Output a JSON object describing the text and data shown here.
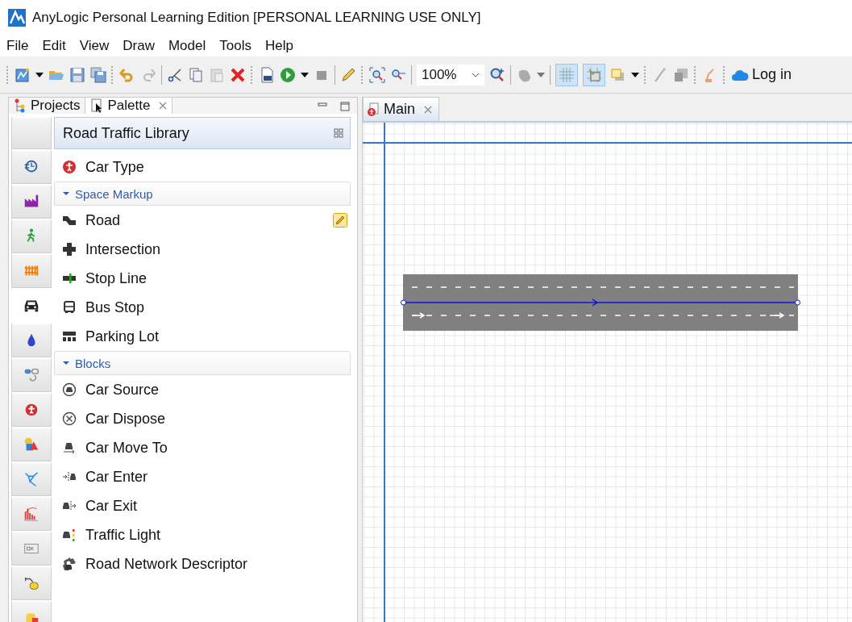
{
  "window": {
    "title": "AnyLogic Personal Learning Edition [PERSONAL LEARNING USE ONLY]"
  },
  "menu": [
    "File",
    "Edit",
    "View",
    "Draw",
    "Model",
    "Tools",
    "Help"
  ],
  "toolbar": {
    "zoom": "100%",
    "grid_toggle": {
      "selected": true
    },
    "snap_toggle": {
      "selected": true
    },
    "login": "Log in"
  },
  "panel_tabs": [
    {
      "label": "Projects",
      "selected": false
    },
    {
      "label": "Palette",
      "selected": true
    }
  ],
  "palette": {
    "categories": [
      {
        "kind": "blank",
        "selected": false
      },
      {
        "kind": "process",
        "selected": false
      },
      {
        "kind": "factory",
        "selected": false
      },
      {
        "kind": "pedestrian",
        "selected": false
      },
      {
        "kind": "rail",
        "selected": false
      },
      {
        "kind": "car",
        "selected": true
      },
      {
        "kind": "drop",
        "selected": false
      },
      {
        "kind": "statechart",
        "selected": false
      },
      {
        "kind": "agent",
        "selected": false
      },
      {
        "kind": "shapes",
        "selected": false
      },
      {
        "kind": "network",
        "selected": false
      },
      {
        "kind": "chart",
        "selected": false
      },
      {
        "kind": "ok",
        "selected": false
      },
      {
        "kind": "connect",
        "selected": false
      },
      {
        "kind": "partial",
        "selected": false
      }
    ],
    "library": "Road Traffic Library",
    "top_items": [
      {
        "kind": "type",
        "label": "Car Type",
        "editable": false
      }
    ],
    "sections": [
      {
        "title": "Space Markup",
        "expanded": true,
        "items": [
          {
            "kind": "road",
            "label": "Road",
            "editable": true
          },
          {
            "kind": "intersection",
            "label": "Intersection",
            "editable": false
          },
          {
            "kind": "stopline",
            "label": "Stop Line",
            "editable": false
          },
          {
            "kind": "busstop",
            "label": "Bus Stop",
            "editable": false
          },
          {
            "kind": "parking",
            "label": "Parking Lot",
            "editable": false
          }
        ]
      },
      {
        "title": "Blocks",
        "expanded": true,
        "items": [
          {
            "kind": "source",
            "label": "Car Source",
            "editable": false
          },
          {
            "kind": "dispose",
            "label": "Car Dispose",
            "editable": false
          },
          {
            "kind": "moveto",
            "label": "Car Move To",
            "editable": false
          },
          {
            "kind": "enter",
            "label": "Car Enter",
            "editable": false
          },
          {
            "kind": "exit",
            "label": "Car Exit",
            "editable": false
          },
          {
            "kind": "light",
            "label": "Traffic Light",
            "editable": false
          },
          {
            "kind": "descriptor",
            "label": "Road Network Descriptor",
            "editable": false
          }
        ]
      }
    ]
  },
  "editor_tabs": [
    {
      "label": "Main",
      "selected": true
    }
  ]
}
